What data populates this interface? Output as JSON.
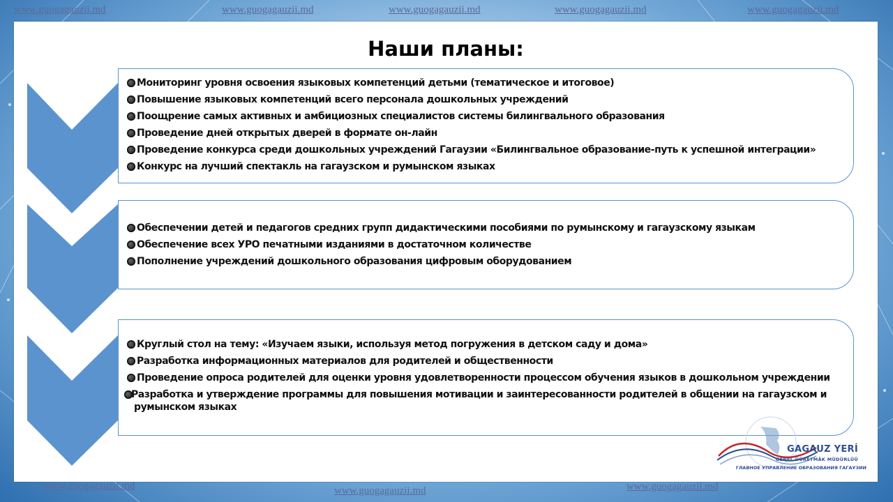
{
  "watermark_text": "www.guogagauzii.md",
  "title": "Наши планы:",
  "sections": [
    {
      "items": [
        "Мониторинг уровня освоения языковых компетенций детьми (тематическое и итоговое)",
        "Повышение языковых компетенций всего персонала дошкольных учреждений",
        "Поощрение самых активных и амбициозных специалистов системы билингвального образования",
        "Проведение дней открытых дверей в формате он-лайн",
        "Проведение  конкурса среди дошкольных учреждений Гагаузии «Билингвальное образование-путь к успешной интеграции»",
        "Конкурс на лучший спектакль на гагаузском и румынском языках"
      ]
    },
    {
      "items": [
        "Обеспечении детей и педагогов средних групп дидактическими пособиями по румынскому и гагаузскому языкам",
        "Обеспечение всех УРО печатными изданиями в достаточном количестве",
        "Пополнение учреждений дошкольного образования цифровым оборудованием"
      ]
    },
    {
      "items": [
        "Круглый стол на тему: «Изучаем языки, используя метод погружения в детском саду и дома»",
        "Разработка информационных материалов для родителей и общественности",
        "Проведение опроса родителей для оценки уровня удовлетворенности процессом обучения языков в дошкольном учреждении",
        "Разработка и утверждение программы для повышения мотивации и заинтересованности родителей в общении на гагаузском и румынском языках"
      ]
    }
  ],
  "logo": {
    "name": "GAGAUZ YERİ",
    "subtitle": "GENEL ÜÜRETMÄK MÜDÜRLÜÜ",
    "subtitle_ru": "ГЛАВНОЕ УПРАВЛЕНИЕ ОБРАЗОВАНИЯ ГАГАУЗИИ"
  },
  "colors": {
    "chevron": "#5b93cf",
    "box_border": "#5b93cf",
    "logo_text": "#2d4f8f",
    "logo_red": "#c0282d"
  },
  "icons": {
    "bullet": "round-bullet-icon",
    "chevron": "chevron-down-arrow-shape"
  }
}
